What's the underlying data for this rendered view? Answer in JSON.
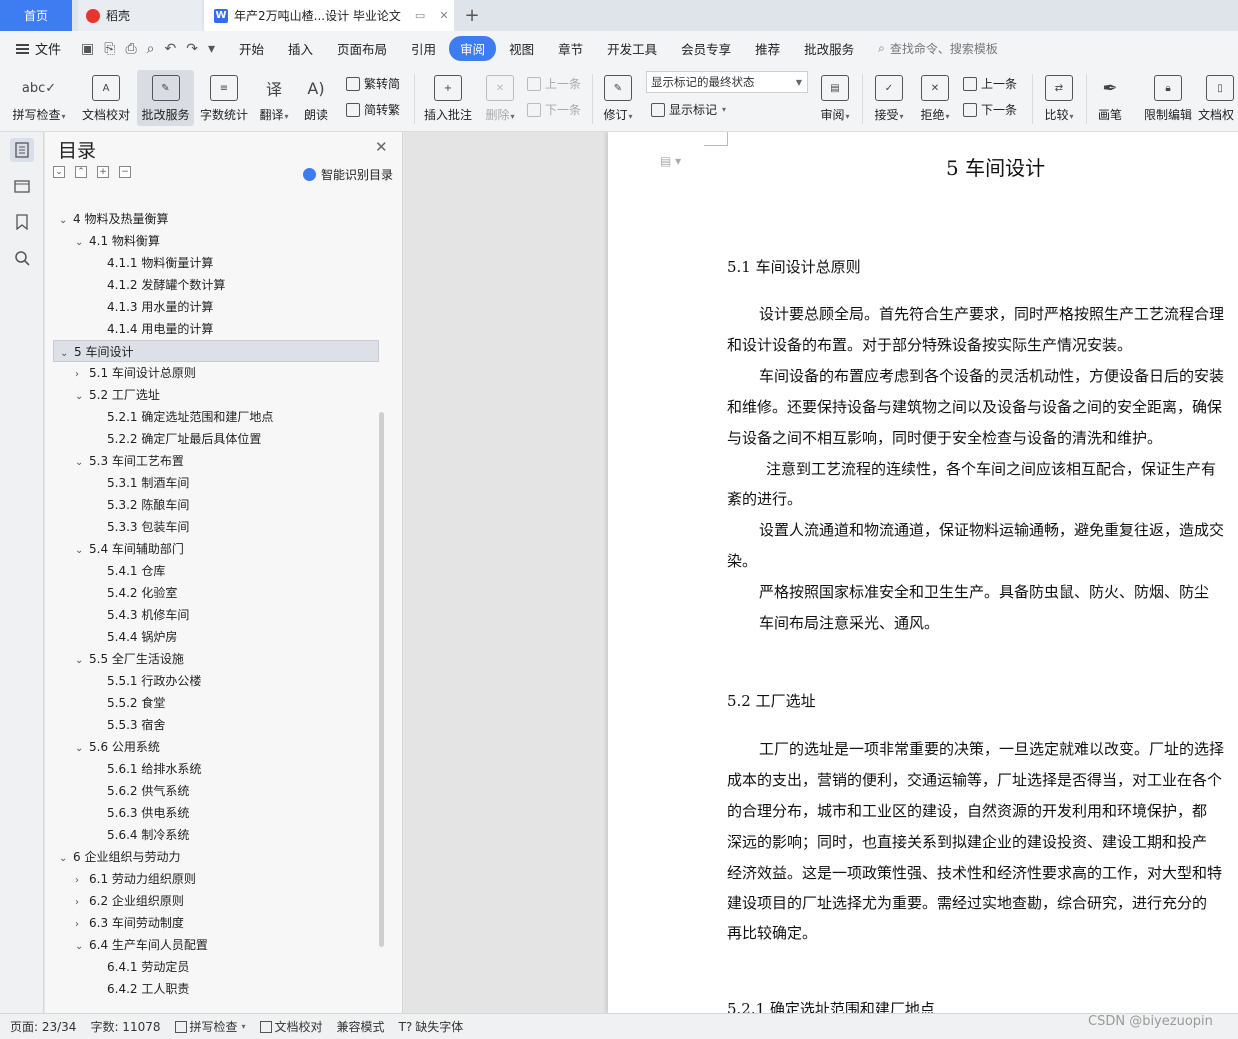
{
  "tabs": {
    "home": "首页",
    "daoke": "稻壳",
    "doc": "年产2万吨山楂...设计 毕业论文"
  },
  "menu": {
    "file": "文件",
    "items": [
      "开始",
      "插入",
      "页面布局",
      "引用",
      "审阅",
      "视图",
      "章节",
      "开发工具",
      "会员专享",
      "推荐",
      "批改服务"
    ],
    "active": "审阅",
    "search": "查找命令、搜索模板"
  },
  "ribbon": {
    "spell": "拼写检查",
    "proof": "文档校对",
    "correct": "批改服务",
    "wordcount": "字数统计",
    "translate": "翻译",
    "read": "朗读",
    "t2s": "繁转简",
    "s2t": "简转繁",
    "insert_comment": "插入批注",
    "delete": "删除",
    "prev": "上一条",
    "next": "下一条",
    "revise": "修订",
    "status_value": "显示标记的最终状态",
    "show_marks": "显示标记",
    "review": "审阅",
    "accept": "接受",
    "reject": "拒绝",
    "prev2": "上一条",
    "next2": "下一条",
    "compare": "比较",
    "pen": "画笔",
    "restrict": "限制编辑",
    "docperm": "文档权"
  },
  "nav": {
    "title": "目录",
    "smart": "智能识别目录",
    "toc": [
      {
        "level": 1,
        "text": "4   物料及热量衡算",
        "expanded": true
      },
      {
        "level": 2,
        "text": "4.1 物料衡算",
        "expanded": true
      },
      {
        "level": 3,
        "text": "4.1.1 物料衡量计算"
      },
      {
        "level": 3,
        "text": "4.1.2 发酵罐个数计算"
      },
      {
        "level": 3,
        "text": "4.1.3 用水量的计算"
      },
      {
        "level": 3,
        "text": "4.1.4 用电量的计算"
      },
      {
        "level": 1,
        "text": "5   车间设计",
        "expanded": true,
        "selected": true
      },
      {
        "level": 2,
        "text": "5.1 车间设计总原则"
      },
      {
        "level": 2,
        "text": "5.2  工厂选址",
        "expanded": true
      },
      {
        "level": 3,
        "text": "5.2.1  确定选址范围和建厂地点"
      },
      {
        "level": 3,
        "text": "5.2.2  确定厂址最后具体位置"
      },
      {
        "level": 2,
        "text": "5.3  车间工艺布置",
        "expanded": true
      },
      {
        "level": 3,
        "text": "5.3.1 制酒车间"
      },
      {
        "level": 3,
        "text": "5.3.2 陈酿车间"
      },
      {
        "level": 3,
        "text": "5.3.3 包装车间"
      },
      {
        "level": 2,
        "text": "5.4 车间辅助部门",
        "expanded": true
      },
      {
        "level": 3,
        "text": "5.4.1 仓库"
      },
      {
        "level": 3,
        "text": "5.4.2 化验室"
      },
      {
        "level": 3,
        "text": "5.4.3 机修车间"
      },
      {
        "level": 3,
        "text": "5.4.4 锅炉房"
      },
      {
        "level": 2,
        "text": "5.5 全厂生活设施",
        "expanded": true
      },
      {
        "level": 3,
        "text": "5.5.1 行政办公楼"
      },
      {
        "level": 3,
        "text": "5.5.2 食堂"
      },
      {
        "level": 3,
        "text": "5.5.3 宿舍"
      },
      {
        "level": 2,
        "text": "5.6 公用系统",
        "expanded": true
      },
      {
        "level": 3,
        "text": "5.6.1 给排水系统"
      },
      {
        "level": 3,
        "text": "5.6.2 供气系统"
      },
      {
        "level": 3,
        "text": "5.6.3 供电系统"
      },
      {
        "level": 3,
        "text": "5.6.4 制冷系统"
      },
      {
        "level": 1,
        "text": "6   企业组织与劳动力",
        "expanded": true
      },
      {
        "level": 2,
        "text": "6.1 劳动力组织原则"
      },
      {
        "level": 2,
        "text": "6.2 企业组织原则"
      },
      {
        "level": 2,
        "text": "6.3 车间劳动制度"
      },
      {
        "level": 2,
        "text": "6.4 生产车间人员配置",
        "expanded": true
      },
      {
        "level": 3,
        "text": "6.4.1  劳动定员"
      },
      {
        "level": 3,
        "text": "6.4.2  工人职责"
      }
    ]
  },
  "document": {
    "chapter_title": "5    车间设计",
    "h_51": "5.1 车间设计总原则",
    "p1": [
      "设计要总顾全局。首先符合生产要求，同时严格按照生产工艺流程合理",
      "和设计设备的布置。对于部分特殊设备按实际生产情况安装。"
    ],
    "p2": [
      "车间设备的布置应考虑到各个设备的灵活机动性，方便设备日后的安装",
      "和维修。还要保持设备与建筑物之间以及设备与设备之间的安全距离，确保",
      "与设备之间不相互影响，同时便于安全检查与设备的清洗和维护。"
    ],
    "p3": [
      "注意到工艺流程的连续性，各个车间之间应该相互配合，保证生产有",
      "紊的进行。"
    ],
    "p4": [
      "设置人流通道和物流通道，保证物料运输通畅，避免重复往返，造成交",
      "染。"
    ],
    "p5": "严格按照国家标准安全和卫生生产。具备防虫鼠、防火、防烟、防尘",
    "p6": "车间布局注意采光、通风。",
    "h_52": "5.2  工厂选址",
    "p7": [
      "工厂的选址是一项非常重要的决策，一旦选定就难以改变。厂址的选择",
      "成本的支出，营销的便利，交通运输等，厂址选择是否得当，对工业在各个",
      "的合理分布，城市和工业区的建设，自然资源的开发利用和环境保护，都",
      "深远的影响；同时，也直接关系到拟建企业的建设投资、建设工期和投产",
      "经济效益。这是一项政策性强、技术性和经济性要求高的工作，对大型和特",
      "建设项目的厂址选择尤为重要。需经过实地查勘，综合研究，进行充分的",
      "再比较确定。"
    ],
    "h_521": "5.2.1  确定选址范围和建厂地点"
  },
  "status": {
    "page": "页面: 23/34",
    "words": "字数: 11078",
    "spell": "拼写检查",
    "proof": "文档校对",
    "compat": "兼容模式",
    "missing_font": "缺失字体"
  },
  "watermark": "CSDN @biyezuopin"
}
